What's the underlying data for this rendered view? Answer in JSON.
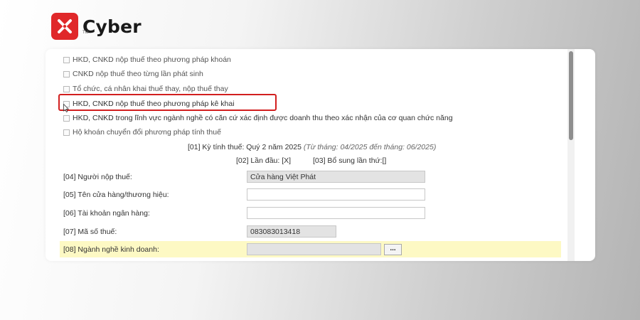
{
  "brand": {
    "name": "Cyber",
    "tm": "TM"
  },
  "checkboxes": [
    {
      "label": "HKD, CNKD nộp thuế theo phương pháp khoán"
    },
    {
      "label": "CNKD nộp thuế theo từng lần phát sinh"
    },
    {
      "label": "Tổ chức, cá nhân khai thuế thay, nộp thuế thay"
    },
    {
      "label": "HKD, CNKD nộp thuế theo phương pháp kê khai"
    },
    {
      "label": "HKD, CNKD trong lĩnh vực ngành nghề có căn cứ xác định được doanh thu theo xác nhận của cơ quan chức năng"
    },
    {
      "label": "Hộ khoán chuyển đổi phương pháp tính thuế"
    }
  ],
  "period": {
    "label": "[01] Kỳ tính thuế: Quý 2 năm 2025",
    "note": "(Từ tháng: 04/2025 đến tháng: 06/2025)"
  },
  "submission": {
    "first": "[02] Lần đầu: [X]",
    "supplement": "[03] Bổ sung lần thứ:[]"
  },
  "fields": {
    "taxpayer": {
      "label": "[04] Người nộp thuế:",
      "value": "Cửa hàng Việt Phát"
    },
    "store_name": {
      "label": "[05] Tên cửa hàng/thương hiệu:",
      "value": ""
    },
    "bank_account": {
      "label": "[06] Tài khoản ngân hàng:",
      "value": ""
    },
    "tax_code": {
      "label": "[07] Mã số thuế:",
      "value": "083083013418"
    },
    "business_line": {
      "label": "[08] Ngành nghề kinh doanh:",
      "value": "",
      "button": "..."
    }
  },
  "colors": {
    "brand_red": "#e0282a",
    "highlight_red": "#d21f1f",
    "row_highlight": "#fdf9c4"
  }
}
